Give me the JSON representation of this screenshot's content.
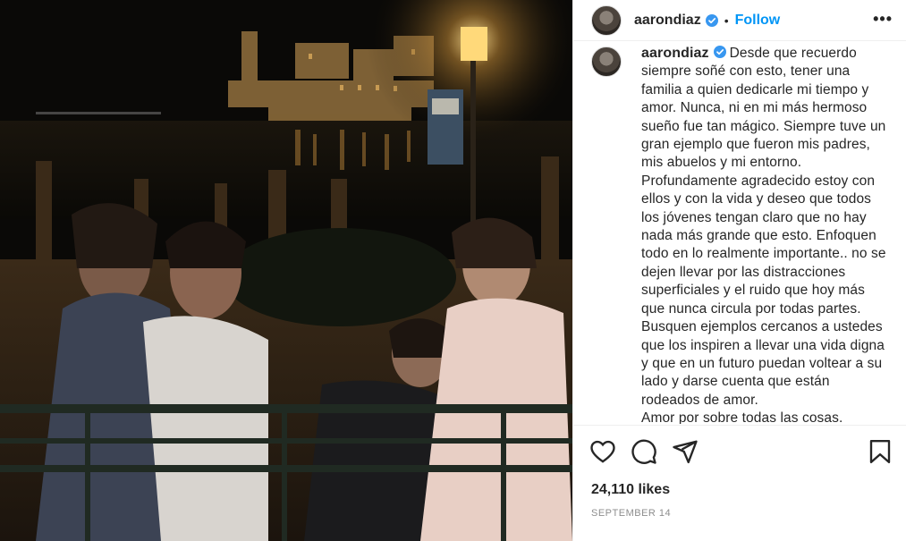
{
  "post": {
    "photo_alt": "Family photo at night by a lake",
    "header": {
      "username": "aarondiaz",
      "separator": "•",
      "follow_label": "Follow",
      "more_label": "•••"
    },
    "caption": {
      "username": "aarondiaz",
      "lines": [
        "Desde que recuerdo",
        "siempre soñé con esto, tener una",
        "familia a quien dedicarle mi tiempo y",
        "amor. Nunca, ni en mi más hermoso",
        "sueño fue tan mágico. Siempre tuve un",
        "gran ejemplo que fueron mis padres,",
        "mis abuelos y mi entorno.",
        "Profundamente agradecido estoy con",
        "ellos y con la vida y deseo que todos",
        "los jóvenes tengan claro que no hay",
        "nada más grande que esto. Enfoquen",
        "todo en lo realmente importante.. no se",
        "dejen llevar por las distracciones",
        "superficiales y el ruido que hoy más",
        "que nunca circula por todas partes.",
        "Busquen ejemplos cercanos a ustedes",
        "que los inspiren a llevar una vida digna",
        "y que en un futuro puedan voltear a su",
        "lado y darse cuenta que están",
        "rodeados de amor.",
        "Amor por sobre todas las cosas."
      ]
    },
    "likes": "24,110 likes",
    "date": "SEPTEMBER 14",
    "icons": {
      "like": "heart-icon",
      "comment": "comment-icon",
      "share": "share-icon",
      "save": "bookmark-icon",
      "verified": "verified-badge-icon"
    },
    "colors": {
      "follow": "#0095f6",
      "verified": "#3897f0",
      "text": "#262626",
      "muted": "#8e8e8e"
    }
  }
}
